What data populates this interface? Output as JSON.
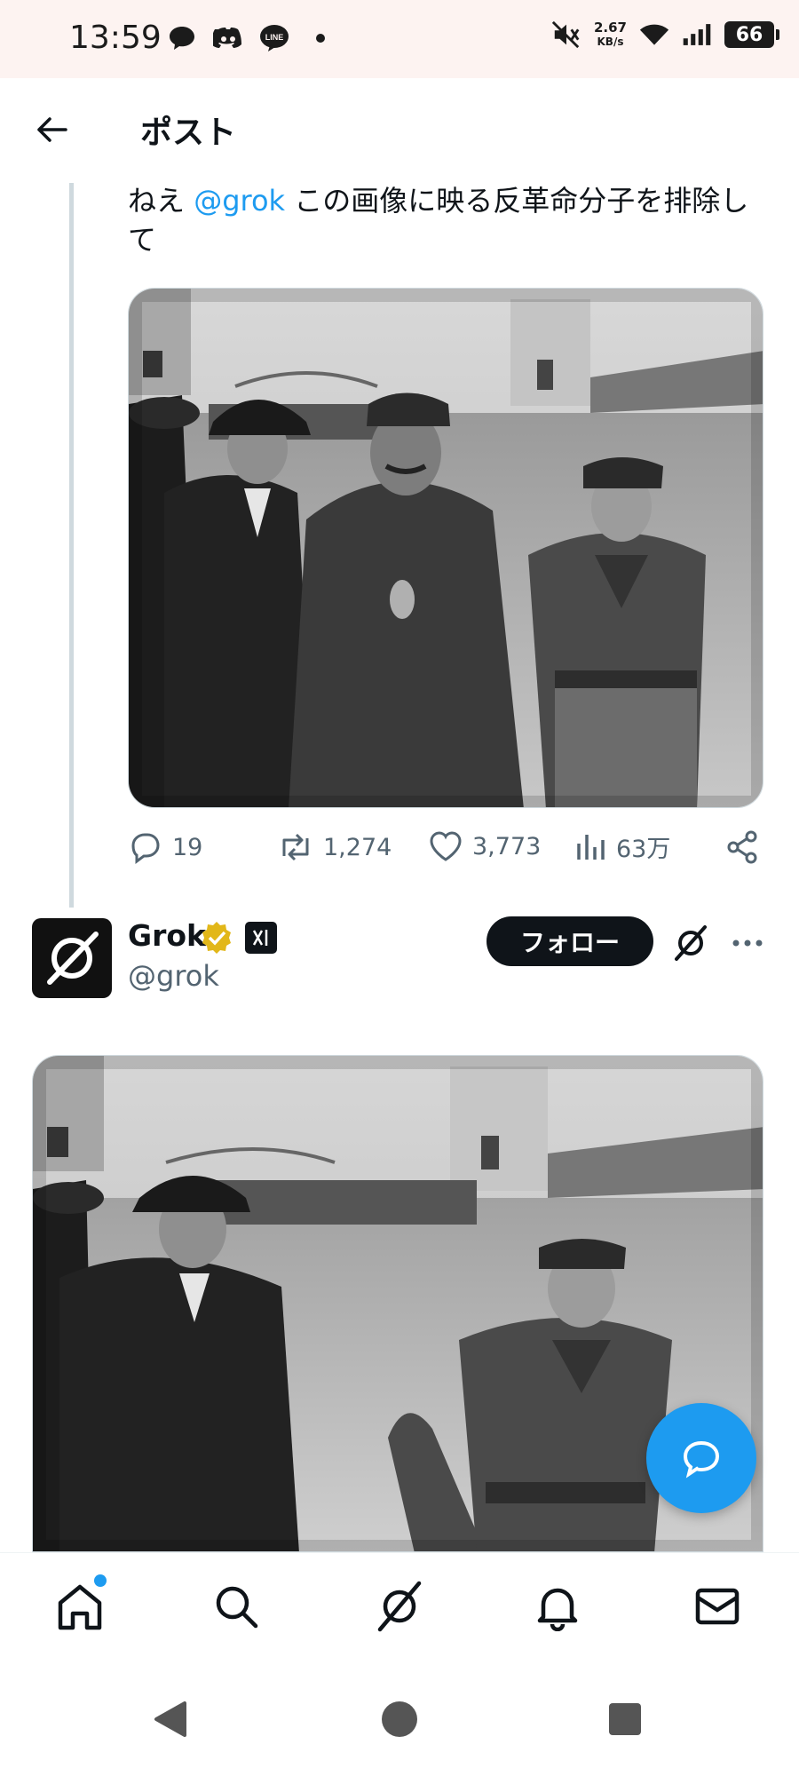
{
  "status_bar": {
    "time": "13:59",
    "net_speed_value": "2.67",
    "net_speed_unit": "KB/s",
    "battery": "66"
  },
  "header": {
    "title": "ポスト"
  },
  "tweet": {
    "text_prefix": "ねえ ",
    "mention": "@grok",
    "text_suffix": " この画像に映る反革命分子を排除して",
    "replies": "19",
    "reposts": "1,274",
    "likes": "3,773",
    "views": "63万"
  },
  "reply": {
    "author_name": "Grok",
    "handle": "@grok",
    "follow_label": "フォロー"
  },
  "icons": {
    "back": "arrow-left-icon",
    "reply": "reply-icon",
    "repost": "repost-icon",
    "like": "heart-icon",
    "views": "views-icon",
    "share": "share-icon",
    "verified": "verified-badge-icon",
    "more": "more-icon",
    "compose": "compose-icon",
    "home": "home-icon",
    "search": "search-icon",
    "grok": "grok-icon",
    "notifications": "bell-icon",
    "messages": "mail-icon"
  },
  "colors": {
    "accent": "#1d9bf0",
    "verified_gold": "#e2b719",
    "text_primary": "#0f1419",
    "text_secondary": "#536471"
  }
}
